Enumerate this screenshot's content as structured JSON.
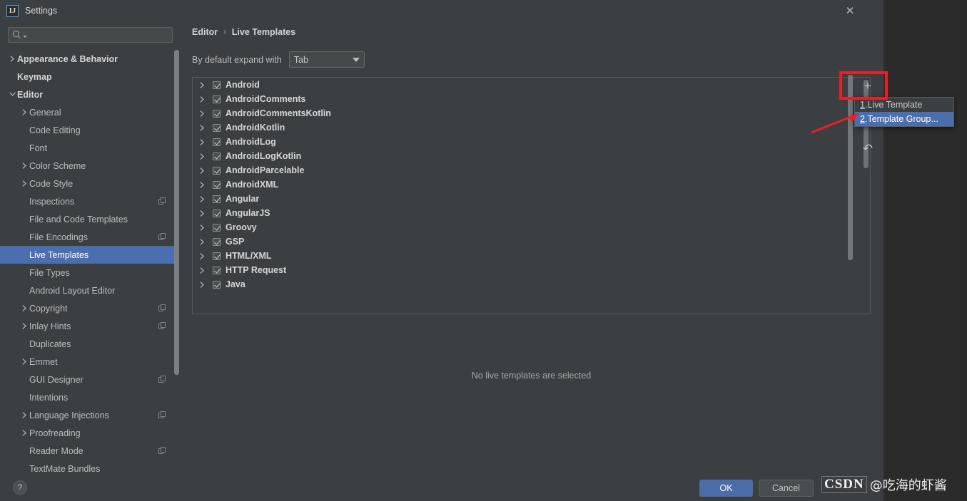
{
  "window": {
    "title": "Settings",
    "icon": "intellij-logo-icon",
    "close_label": "✕"
  },
  "search": {
    "value": "",
    "placeholder": "",
    "icon": "search-icon"
  },
  "sidebar": {
    "items": [
      {
        "label": "Appearance & Behavior",
        "level": 0,
        "arrow": "right",
        "bold": true,
        "badge": false,
        "selected": false
      },
      {
        "label": "Keymap",
        "level": 0,
        "arrow": "none",
        "bold": true,
        "badge": false,
        "selected": false
      },
      {
        "label": "Editor",
        "level": 0,
        "arrow": "down",
        "bold": true,
        "badge": false,
        "selected": false
      },
      {
        "label": "General",
        "level": 1,
        "arrow": "right",
        "bold": false,
        "badge": false,
        "selected": false
      },
      {
        "label": "Code Editing",
        "level": 1,
        "arrow": "none",
        "bold": false,
        "badge": false,
        "selected": false
      },
      {
        "label": "Font",
        "level": 1,
        "arrow": "none",
        "bold": false,
        "badge": false,
        "selected": false
      },
      {
        "label": "Color Scheme",
        "level": 1,
        "arrow": "right",
        "bold": false,
        "badge": false,
        "selected": false
      },
      {
        "label": "Code Style",
        "level": 1,
        "arrow": "right",
        "bold": false,
        "badge": false,
        "selected": false
      },
      {
        "label": "Inspections",
        "level": 1,
        "arrow": "none",
        "bold": false,
        "badge": true,
        "selected": false
      },
      {
        "label": "File and Code Templates",
        "level": 1,
        "arrow": "none",
        "bold": false,
        "badge": false,
        "selected": false
      },
      {
        "label": "File Encodings",
        "level": 1,
        "arrow": "none",
        "bold": false,
        "badge": true,
        "selected": false
      },
      {
        "label": "Live Templates",
        "level": 1,
        "arrow": "none",
        "bold": false,
        "badge": false,
        "selected": true
      },
      {
        "label": "File Types",
        "level": 1,
        "arrow": "none",
        "bold": false,
        "badge": false,
        "selected": false
      },
      {
        "label": "Android Layout Editor",
        "level": 1,
        "arrow": "none",
        "bold": false,
        "badge": false,
        "selected": false
      },
      {
        "label": "Copyright",
        "level": 1,
        "arrow": "right",
        "bold": false,
        "badge": true,
        "selected": false
      },
      {
        "label": "Inlay Hints",
        "level": 1,
        "arrow": "right",
        "bold": false,
        "badge": true,
        "selected": false
      },
      {
        "label": "Duplicates",
        "level": 1,
        "arrow": "none",
        "bold": false,
        "badge": false,
        "selected": false
      },
      {
        "label": "Emmet",
        "level": 1,
        "arrow": "right",
        "bold": false,
        "badge": false,
        "selected": false
      },
      {
        "label": "GUI Designer",
        "level": 1,
        "arrow": "none",
        "bold": false,
        "badge": true,
        "selected": false
      },
      {
        "label": "Intentions",
        "level": 1,
        "arrow": "none",
        "bold": false,
        "badge": false,
        "selected": false
      },
      {
        "label": "Language Injections",
        "level": 1,
        "arrow": "right",
        "bold": false,
        "badge": true,
        "selected": false
      },
      {
        "label": "Proofreading",
        "level": 1,
        "arrow": "right",
        "bold": false,
        "badge": false,
        "selected": false
      },
      {
        "label": "Reader Mode",
        "level": 1,
        "arrow": "none",
        "bold": false,
        "badge": true,
        "selected": false
      },
      {
        "label": "TextMate Bundles",
        "level": 1,
        "arrow": "none",
        "bold": false,
        "badge": false,
        "selected": false
      }
    ]
  },
  "main": {
    "breadcrumb": {
      "parent": "Editor",
      "separator": "›",
      "current": "Live Templates"
    },
    "expand_with": {
      "label": "By default expand with",
      "value": "Tab"
    },
    "empty_message": "No live templates are selected",
    "groups": [
      {
        "label": "Android",
        "checked": true
      },
      {
        "label": "AndroidComments",
        "checked": true
      },
      {
        "label": "AndroidCommentsKotlin",
        "checked": true
      },
      {
        "label": "AndroidKotlin",
        "checked": true
      },
      {
        "label": "AndroidLog",
        "checked": true
      },
      {
        "label": "AndroidLogKotlin",
        "checked": true
      },
      {
        "label": "AndroidParcelable",
        "checked": true
      },
      {
        "label": "AndroidXML",
        "checked": true
      },
      {
        "label": "Angular",
        "checked": true
      },
      {
        "label": "AngularJS",
        "checked": true
      },
      {
        "label": "Groovy",
        "checked": true
      },
      {
        "label": "GSP",
        "checked": true
      },
      {
        "label": "HTML/XML",
        "checked": true
      },
      {
        "label": "HTTP Request",
        "checked": true
      },
      {
        "label": "Java",
        "checked": true
      }
    ]
  },
  "toolbar": {
    "add_label": "+",
    "add_icon": "plus-icon",
    "revert_icon": "undo-arrow-icon",
    "revert_label": "↶"
  },
  "popup": {
    "items": [
      {
        "num": "1",
        "sep": ". ",
        "label": "Live Template",
        "active": false
      },
      {
        "num": "2",
        "sep": ". ",
        "label": "Template Group...",
        "active": true
      }
    ]
  },
  "footer": {
    "help_label": "?",
    "help_icon": "question-mark-icon",
    "ok_label": "OK",
    "cancel_label": "Cancel"
  },
  "watermark": {
    "brand": "CSDN",
    "user": "@吃海的虾酱"
  },
  "colors": {
    "accent": "#4b6eaf",
    "annotation": "#ee1c25",
    "panel_bg": "#3c3f41",
    "app_bg": "#2b2b2b"
  }
}
